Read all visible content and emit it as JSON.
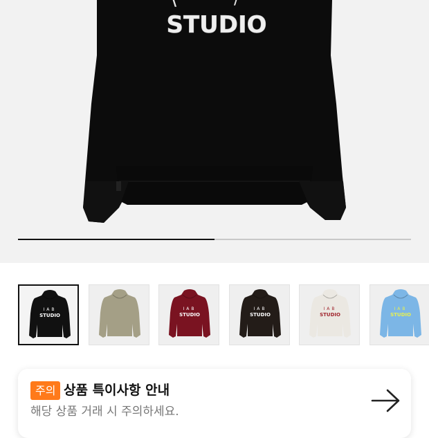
{
  "hero": {
    "print_text": "STUDIO",
    "image_position": 1,
    "image_count": 2
  },
  "thumbnails": [
    {
      "color": "#111111",
      "print_color": "#ffffff",
      "print_text": "STUDIO",
      "logo_text": "IAB",
      "selected": true
    },
    {
      "color": "#a49f86",
      "print_color": "#6b6656",
      "print_text": "",
      "logo_text": "",
      "selected": false
    },
    {
      "color": "#7a1321",
      "print_color": "#ffffff",
      "print_text": "STUDIO",
      "logo_text": "IAB",
      "selected": false
    },
    {
      "color": "#231c18",
      "print_color": "#ffffff",
      "print_text": "STUDIO",
      "logo_text": "IAB",
      "selected": false
    },
    {
      "color": "#ebe8e2",
      "print_color": "#a0262e",
      "print_text": "STUDIO",
      "logo_text": "IAB",
      "selected": false
    },
    {
      "color": "#7cb6e6",
      "print_color": "#e8f050",
      "print_text": "STUDIO",
      "logo_text": "IAB",
      "selected": false
    }
  ],
  "notice": {
    "badge": "주의",
    "title": "상품 특이사항 안내",
    "subtitle": "해당 상품 거래 시 주의하세요.",
    "arrow_icon": "arrow-right-icon",
    "badge_color": "#ff7a1a"
  }
}
